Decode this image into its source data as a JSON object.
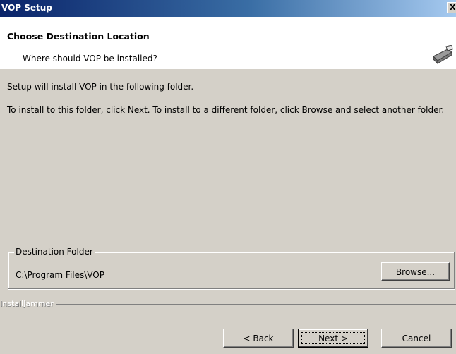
{
  "window": {
    "title": "VOP Setup",
    "close_label": "X"
  },
  "header": {
    "title": "Choose Destination Location",
    "subtitle": "Where should VOP be installed?",
    "icon": "installer-disk-icon"
  },
  "body": {
    "intro": "Setup will install VOP in the following folder.",
    "instructions": "To install to this folder, click Next.  To install to a different folder, click Browse and select another folder."
  },
  "destination": {
    "legend": "Destination Folder",
    "path": "C:\\Program Files\\VOP",
    "browse_label": "Browse..."
  },
  "footer": {
    "brand": "InstallJammer",
    "back_label": "< Back",
    "next_label": "Next >",
    "cancel_label": "Cancel"
  }
}
